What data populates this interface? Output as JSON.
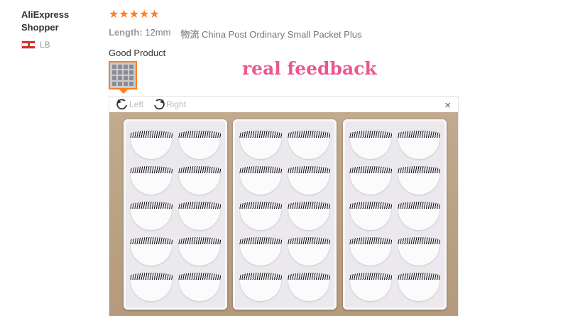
{
  "buyer": {
    "name": "AliExpress Shopper",
    "country": "LB"
  },
  "review": {
    "rating": 5,
    "stars": "★★★★★",
    "length_label": "Length:",
    "length_value": "12mm",
    "shipping_label": "物流",
    "shipping_value": "China Post Ordinary Small Packet Plus",
    "text": "Good Product"
  },
  "overlay_text": "real feedback",
  "viewer": {
    "rotate_left": "Left",
    "rotate_right": "Right",
    "close": "×"
  },
  "colors": {
    "star": "#ff7f22",
    "overlay": "#e9588f",
    "accent": "#ff7f22"
  }
}
